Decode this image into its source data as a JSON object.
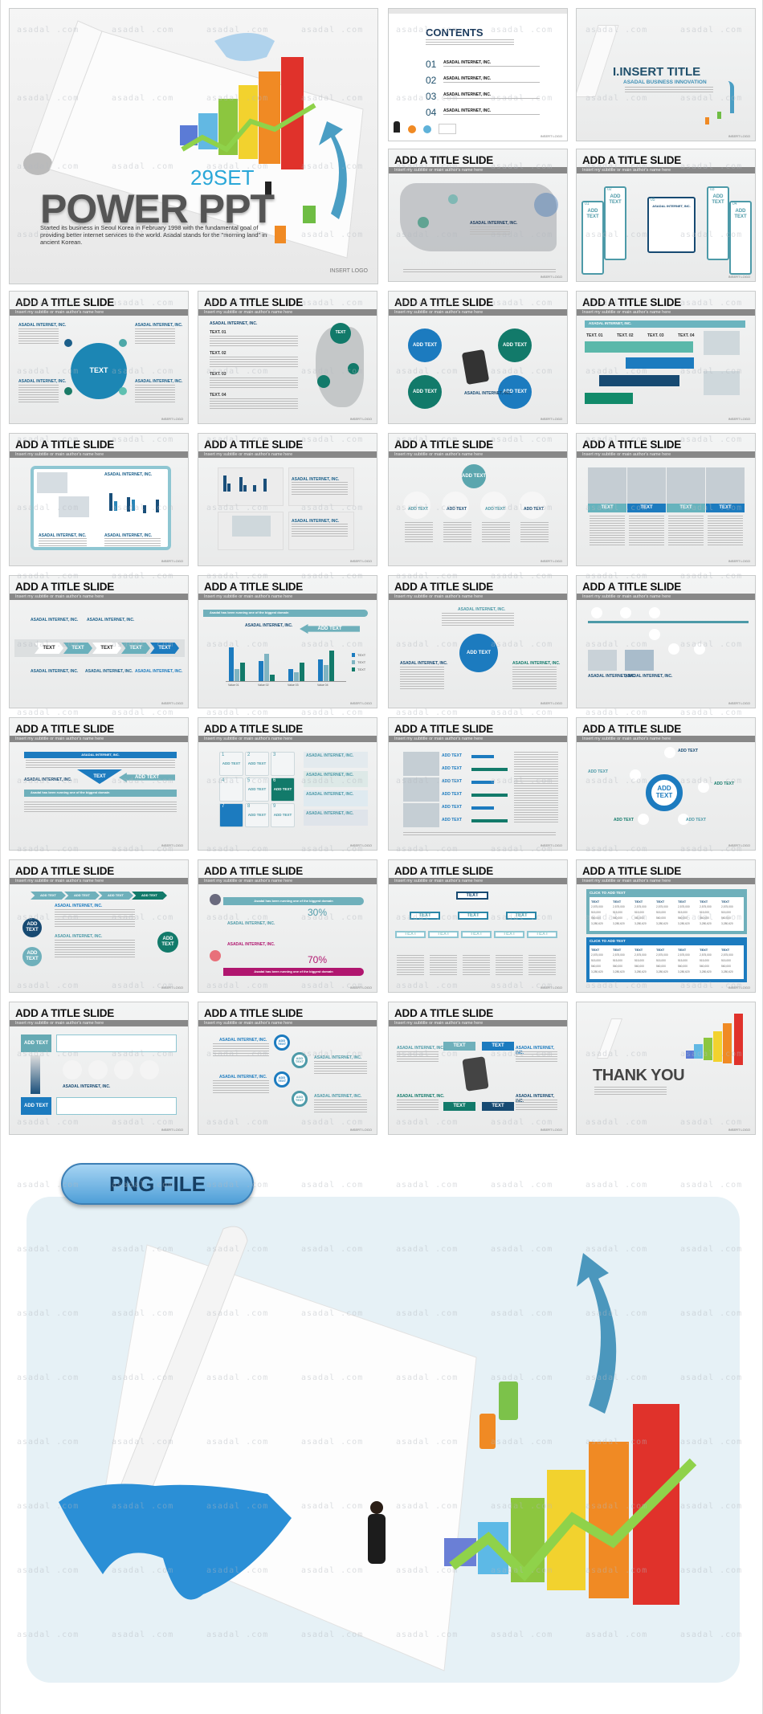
{
  "watermark": "asadal .com",
  "slide_common": {
    "title": "ADD A TITLE SLIDE",
    "subtitle": "Insert my subtitle or main author's name here",
    "logo": "INSERT LOGO",
    "company": "ASADAL INTERNET, INC.",
    "add_text": "ADD TEXT",
    "text": "TEXT"
  },
  "title_slide": {
    "set_label": "29SET",
    "title": "POWER PPT",
    "description": "Started its business in Seoul Korea in February 1998 with the fundamental goal of providing better internet services to the world. Asadal stands for the \"morning land\" in ancient Korean.",
    "logo": "INSERT LOGO"
  },
  "contents_slide": {
    "title": "CONTENTS",
    "items": [
      {
        "num": "01",
        "label": "ASADAL INTERNET, INC."
      },
      {
        "num": "02",
        "label": "ASADAL INTERNET, INC."
      },
      {
        "num": "03",
        "label": "ASADAL INTERNET, INC."
      },
      {
        "num": "04",
        "label": "ASADAL INTERNET, INC."
      }
    ]
  },
  "section_slide": {
    "title": "I.INSERT TITLE",
    "subtitle": "ASADAL BUSINESS INNOVATION"
  },
  "five_box_slide": {
    "numbers": [
      "01",
      "02",
      "05",
      "03",
      "04"
    ]
  },
  "korea_map_slide": {
    "items": [
      "TEXT. 01",
      "TEXT. 02",
      "TEXT. 03",
      "TEXT. 04"
    ]
  },
  "process_slide": {
    "steps": [
      "TEXT. 01",
      "TEXT. 02",
      "TEXT. 03",
      "TEXT. 04"
    ]
  },
  "bar_chart_slide": {
    "banner": "Asadal has been running one of the biggest domain",
    "categories": [
      "Value 01",
      "Value 02",
      "Value 03",
      "Value 04"
    ],
    "series": [
      {
        "name": "TEXT",
        "color": "#1c7bbf",
        "values": [
          5.5,
          3.2,
          2,
          3.5
        ]
      },
      {
        "name": "TEXT",
        "color": "#7fb4c2",
        "values": [
          2,
          4.5,
          1.4,
          2.6
        ]
      },
      {
        "name": "TEXT",
        "color": "#127a6a",
        "values": [
          3,
          1,
          3,
          5
        ]
      }
    ]
  },
  "grid_slide": {
    "cells": [
      "1",
      "2",
      "3",
      "4",
      "5",
      "6",
      "7",
      "8",
      "9"
    ]
  },
  "people_slide": {
    "top_pct": "30%",
    "bottom_pct": "70%",
    "pct_note": "(ADD TEXT)"
  },
  "table_slide": {
    "header": "CLICK TO ADD TEXT",
    "unit": "(UNIT : WON)",
    "values": [
      "2,575,000",
      "515,000",
      "560,000",
      "3,280,620"
    ]
  },
  "thank_you": {
    "title": "THANK YOU"
  },
  "png_section": {
    "badge": "PNG FILE"
  },
  "colors": {
    "teal": "#4d9aa8",
    "blue": "#1c7bbf",
    "navy": "#174a72",
    "green": "#127a6a",
    "magenta": "#b0166f"
  }
}
